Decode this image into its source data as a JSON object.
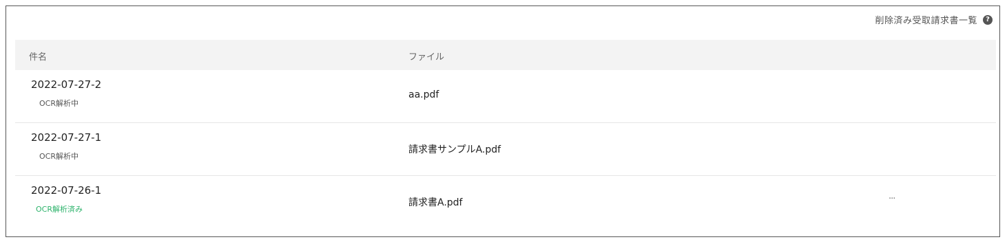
{
  "header": {
    "deleted_link_label": "削除済み受取請求書一覧",
    "help_icon": "question-circle-icon"
  },
  "table": {
    "columns": {
      "subject": "件名",
      "file": "ファイル"
    },
    "rows": [
      {
        "subject": "2022-07-27-2",
        "status": "OCR解析中",
        "status_type": "processing",
        "file": "aa.pdf"
      },
      {
        "subject": "2022-07-27-1",
        "status": "OCR解析中",
        "status_type": "processing",
        "file": "請求書サンプルA.pdf"
      },
      {
        "subject": "2022-07-26-1",
        "status": "OCR解析済み",
        "status_type": "done",
        "file": "請求書A.pdf",
        "more": "···"
      }
    ]
  },
  "colors": {
    "status_done": "#2db36b",
    "status_processing": "#555555",
    "header_bg": "#f3f3f3"
  }
}
